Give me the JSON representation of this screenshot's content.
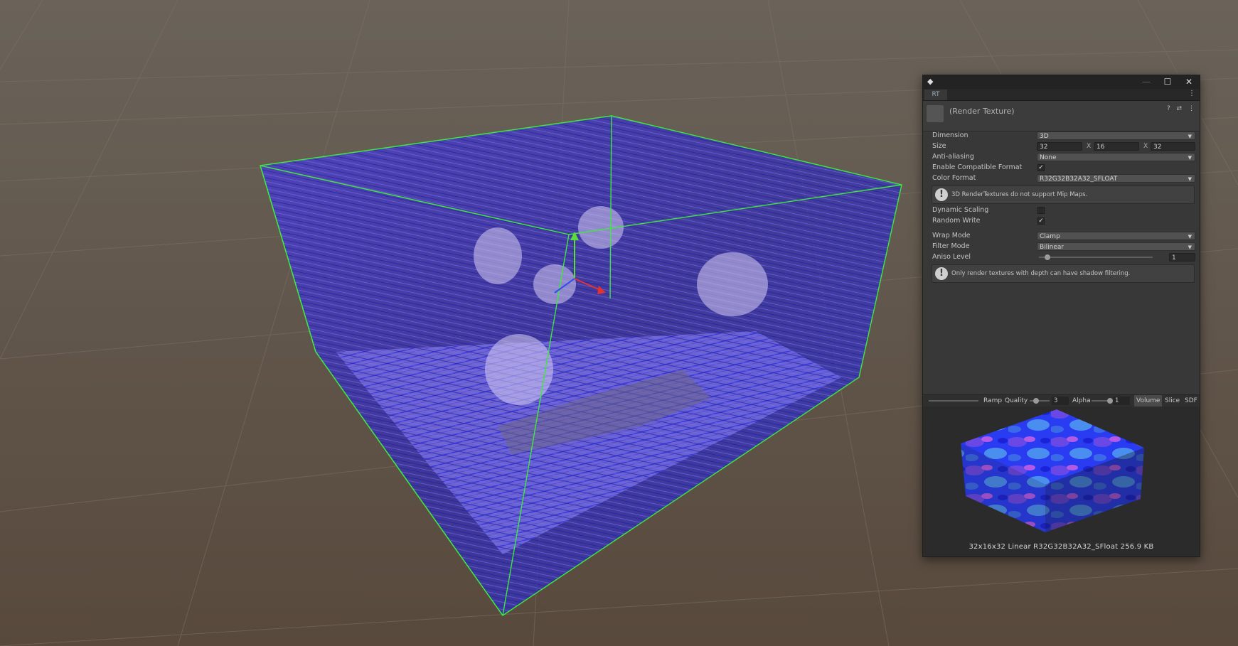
{
  "inspector": {
    "object_title": "(Render Texture)",
    "header_icons": "? ⇄ ⋮",
    "window_controls": {
      "minimize": "—",
      "maximize": "☐",
      "close": "✕"
    },
    "tab_icon": "RT",
    "menu_icon": "⋮",
    "logo_icon": "◆",
    "properties": {
      "dimension": {
        "label": "Dimension",
        "value": "3D"
      },
      "size": {
        "label": "Size",
        "x": "32",
        "y": "16",
        "z": "32",
        "sep": "X"
      },
      "anti_aliasing": {
        "label": "Anti-aliasing",
        "value": "None"
      },
      "enable_compatible_format": {
        "label": "Enable Compatible Format",
        "checked": true
      },
      "color_format": {
        "label": "Color Format",
        "value": "R32G32B32A32_SFLOAT"
      },
      "mip_help": "3D RenderTextures do not support Mip Maps.",
      "dynamic_scaling": {
        "label": "Dynamic Scaling",
        "checked": false
      },
      "random_write": {
        "label": "Random Write",
        "checked": true
      },
      "wrap_mode": {
        "label": "Wrap Mode",
        "value": "Clamp"
      },
      "filter_mode": {
        "label": "Filter Mode",
        "value": "Bilinear"
      },
      "aniso_level": {
        "label": "Aniso Level",
        "value": "1",
        "fraction": 0.0
      },
      "shadow_help": "Only render textures with depth can have shadow filtering."
    },
    "preview_toolbar": {
      "ramp": "Ramp",
      "quality_label": "Quality",
      "quality_value": "3",
      "alpha_label": "Alpha",
      "alpha_value": "1",
      "volume": "Volume",
      "slice": "Slice",
      "sdf": "SDF"
    },
    "preview_info": "32x16x32 Linear  R32G32B32A32_SFloat  256.9 KB"
  },
  "checkmark": "✓",
  "caret": "▼",
  "warning_glyph": "!",
  "colors": {
    "bounds_green": "#3ee83e",
    "vector_blue": "#3a2cf0",
    "vector_violet": "#9a3ae8",
    "ground_brown": "#5e5347",
    "inspector_bg": "#383838"
  }
}
